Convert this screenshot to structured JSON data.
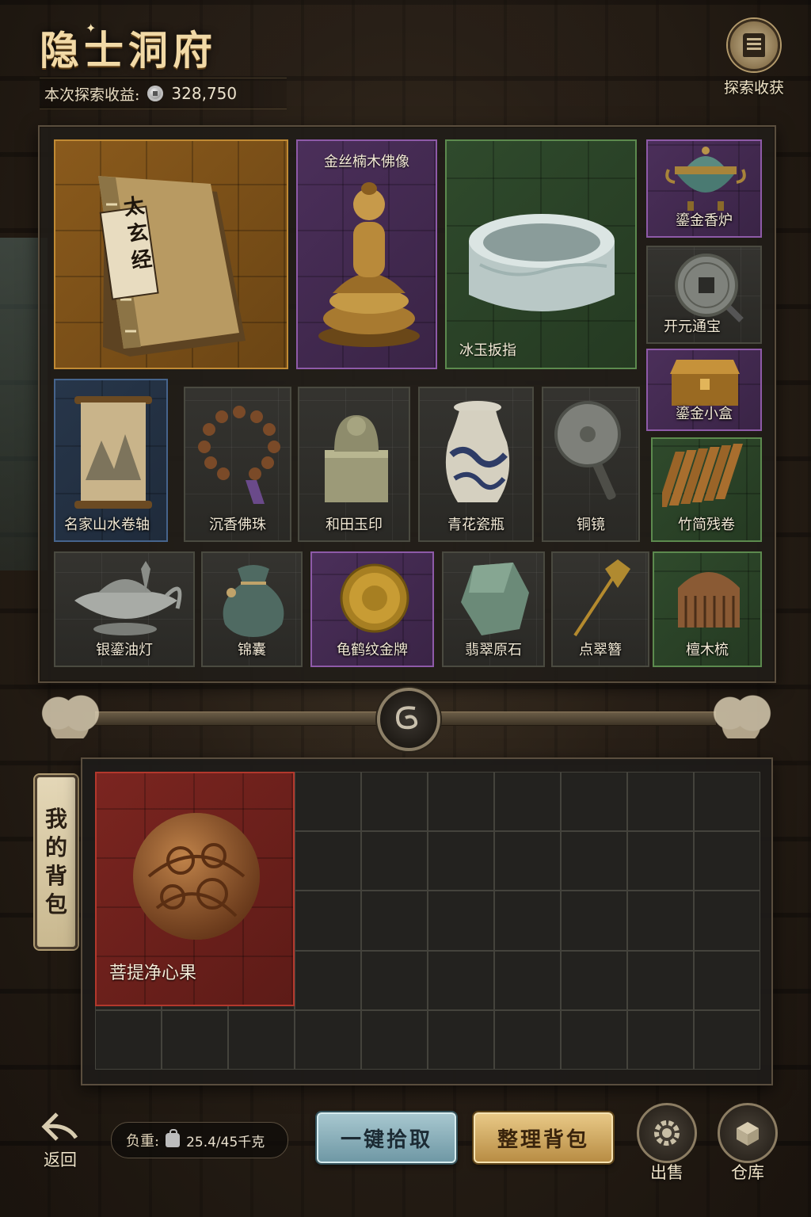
{
  "header": {
    "title": "隐士洞府",
    "earnings_label": "本次探索收益:",
    "earnings_value": "328,750",
    "explore_button_label": "探索收获"
  },
  "loot": {
    "items": [
      {
        "name": "太玄经",
        "rarity": "gold"
      },
      {
        "name": "金丝楠木佛像",
        "rarity": "purple"
      },
      {
        "name": "冰玉扳指",
        "rarity": "green"
      },
      {
        "name": "鎏金香炉",
        "rarity": "purple"
      },
      {
        "name": "开元通宝",
        "rarity": "plain"
      },
      {
        "name": "鎏金小盒",
        "rarity": "purple"
      },
      {
        "name": "名家山水卷轴",
        "rarity": "blue"
      },
      {
        "name": "沉香佛珠",
        "rarity": "blue"
      },
      {
        "name": "和田玉印",
        "rarity": "plain"
      },
      {
        "name": "青花瓷瓶",
        "rarity": "plain"
      },
      {
        "name": "铜镜",
        "rarity": "plain"
      },
      {
        "name": "竹简残卷",
        "rarity": "green"
      },
      {
        "name": "银鎏油灯",
        "rarity": "blue"
      },
      {
        "name": "锦囊",
        "rarity": "plain"
      },
      {
        "name": "龟鹤纹金牌",
        "rarity": "purple"
      },
      {
        "name": "翡翠原石",
        "rarity": "plain"
      },
      {
        "name": "点翠簪",
        "rarity": "plain"
      },
      {
        "name": "檀木梳",
        "rarity": "green"
      }
    ],
    "book_cover_text": "太玄经"
  },
  "backpack": {
    "tab_label": [
      "我",
      "的",
      "背",
      "包"
    ],
    "item": {
      "name": "菩提净心果",
      "rarity": "red"
    }
  },
  "footer": {
    "back_label": "返回",
    "weight_label": "负重:",
    "weight_value": "25.4/45千克",
    "pickup_all_label": "一键拾取",
    "sort_bag_label": "整理背包",
    "sell_label": "出售",
    "warehouse_label": "仓库"
  },
  "colors": {
    "gold": "#c08a34",
    "purple": "#8e5aa8",
    "green": "#5c8a4e",
    "blue": "#46648c",
    "red": "#b3382c"
  },
  "icons": {
    "coin": "silver-coin-icon",
    "explore": "scroll-icon",
    "back": "back-arrow-icon",
    "weight": "weight-icon",
    "sell": "gear-coin-icon",
    "warehouse": "chest-icon",
    "divider": "dragon-medallion-icon"
  }
}
